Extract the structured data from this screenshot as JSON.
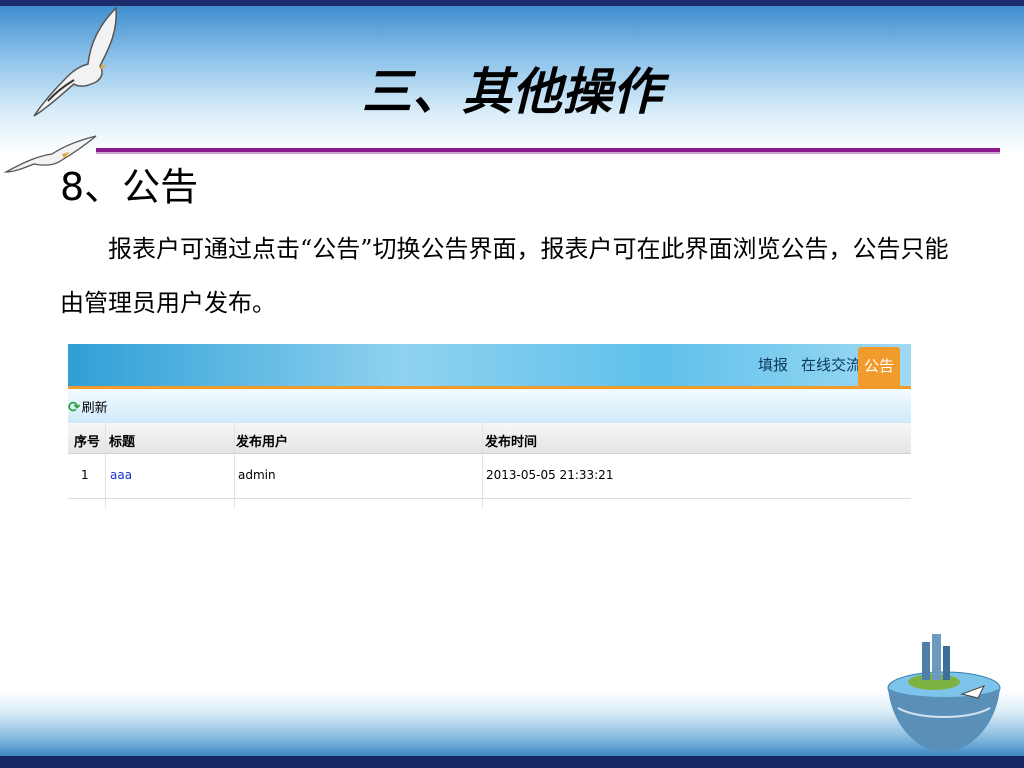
{
  "slide": {
    "title": "三、其他操作",
    "section_heading": "8、公告",
    "body": "报表户可通过点击“公告”切换公告界面，报表户可在此界面浏览公告，公告只能由管理员用户发布。"
  },
  "app": {
    "nav_tabs": [
      {
        "label": "填报",
        "active": false
      },
      {
        "label": "在线交流",
        "active": false
      },
      {
        "label": "公告",
        "active": true
      }
    ],
    "toolbar": {
      "refresh_label": "刷新"
    },
    "table": {
      "columns": [
        "序号",
        "标题",
        "发布用户",
        "发布时间"
      ],
      "rows": [
        {
          "index": "1",
          "title": "aaa",
          "user": "admin",
          "time": "2013-05-05 21:33:21"
        }
      ]
    }
  },
  "colors": {
    "accent_orange": "#f29b2d",
    "title_rule": "#8a1a8c",
    "link_blue": "#1a33c7"
  },
  "icons": [
    "seagull-icon",
    "refresh-icon",
    "globe-island-icon"
  ]
}
